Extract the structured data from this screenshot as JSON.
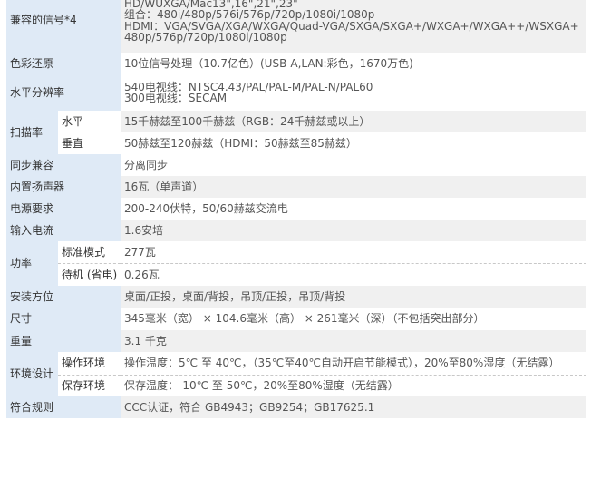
{
  "rows": {
    "compat": {
      "label": "兼容的信号*4",
      "lines": [
        "HD/WUXGA/Mac13\",16\",21\",23\"",
        "组合：480i/480p/576i/576p/720p/1080i/1080p",
        "HDMI：VGA/SVGA/XGA/WXGA/Quad-VGA/SXGA/SXGA+/WXGA+/WXGA++/WSXGA+",
        "480p/576p/720p/1080i/1080p"
      ]
    },
    "color": {
      "label": "色彩还原",
      "value": "10位信号处理（10.7亿色）(USB-A,LAN:彩色，1670万色)"
    },
    "resolution": {
      "label": "水平分辨率",
      "lines": [
        "540电视线：NTSC4.43/PAL/PAL-M/PAL-N/PAL60",
        "300电视线：SECAM"
      ]
    },
    "scan": {
      "label": "扫描率",
      "h_label": "水平",
      "h_value": "15千赫兹至100千赫兹（RGB：24千赫兹或以上）",
      "v_label": "垂直",
      "v_value": "50赫兹至120赫兹（HDMI：50赫兹至85赫兹）"
    },
    "sync": {
      "label": "同步兼容",
      "value": "分离同步"
    },
    "speaker": {
      "label": "内置扬声器",
      "value": "16瓦（单声道）"
    },
    "power": {
      "label": "电源要求",
      "value": "200-240伏特，50/60赫兹交流电"
    },
    "current": {
      "label": "输入电流",
      "value": "1.6安培"
    },
    "consumption": {
      "label": "功率",
      "std_label": "标准模式",
      "std_value": "277瓦",
      "standby_label": "待机 (省电)",
      "standby_value": "0.26瓦"
    },
    "install": {
      "label": "安装方位",
      "value": "桌面/正投，桌面/背投，吊顶/正投，吊顶/背投"
    },
    "size": {
      "label": "尺寸",
      "value": "345毫米（宽） × 104.6毫米（高） × 261毫米（深）（不包括突出部分）"
    },
    "weight": {
      "label": "重量",
      "value": "3.1 千克"
    },
    "env": {
      "label": "环境设计",
      "op_label": "操作环境",
      "op_value": "操作温度：5℃ 至 40℃，（35℃至40℃自动开启节能模式），20%至80%湿度（无结露）",
      "store_label": "保存环境",
      "store_value": "保存温度：-10℃ 至 50℃，20%至80%湿度（无结露）"
    },
    "compliance": {
      "label": "符合规则",
      "value": "CCC认证，符合 GB4943；GB9254；GB17625.1"
    }
  }
}
